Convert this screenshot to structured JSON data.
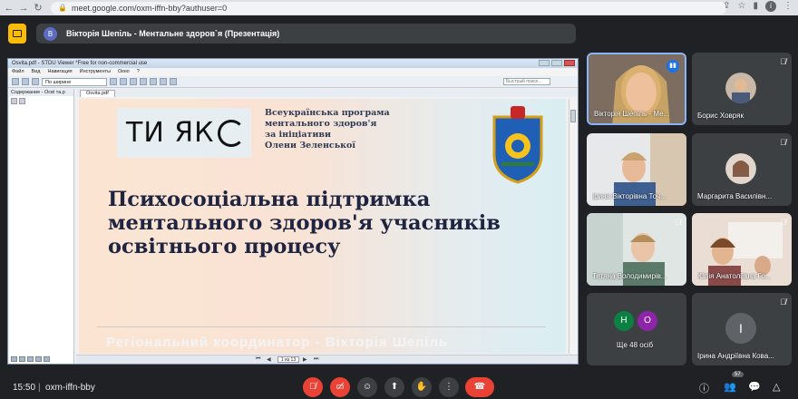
{
  "browser": {
    "url": "meet.google.com/oxm-iffn-bby?authuser=0",
    "profile_initial": "i"
  },
  "meet": {
    "presenter_initial": "В",
    "presentation_title": "Вікторія Шепіль - Ментальне здоров`я (Презентація)",
    "time": "15:50",
    "separator": "|",
    "meeting_code": "oxm-iffn-bby",
    "participant_count": "57"
  },
  "viewer": {
    "window_title": "Osvita.pdf - STDU Viewer *Free for non-commercial use",
    "menu": [
      "Файл",
      "Вид",
      "Навигация",
      "Инструменты",
      "Окно",
      "?"
    ],
    "zoom_select": "По ширине",
    "search_placeholder": "Быстрый поиск...",
    "left_panel_title": "Содержание - Осві та.р",
    "doc_tab": "Osvita.pdf",
    "page_indicator": "1 из 13"
  },
  "slide": {
    "logo_text": "ТИ ЯК",
    "program_lines": [
      "Всеукраїнська програма",
      "ментального здоров'я",
      "за ініціативи",
      "Олени Зеленської"
    ],
    "headline_lines": [
      "Психосоціальна підтримка",
      "ментального здоров'я учасників",
      "освітнього процесу"
    ],
    "footer": "Регіональний координатор  -  Вікторія Шепіль"
  },
  "participants": [
    {
      "name": "Вікторія Шепіль - Ме...",
      "speaking": true
    },
    {
      "name": "Борис Ховряк"
    },
    {
      "name": "Ірина Вікторівна Точ..."
    },
    {
      "name": "Маргарита Василівн..."
    },
    {
      "name": "Тетяна Володимирів..."
    },
    {
      "name": "Юлія Анатоліївна Го..."
    },
    {
      "name": "Ще 48 осіб",
      "initials": [
        "Н",
        "О"
      ]
    },
    {
      "name": "Ірина Андріївна Кова...",
      "initial": "І"
    }
  ],
  "colors": {
    "meet_bg": "#202124",
    "tile_bg": "#3c4043",
    "red": "#ea4335",
    "accent": "#fbbc04"
  }
}
